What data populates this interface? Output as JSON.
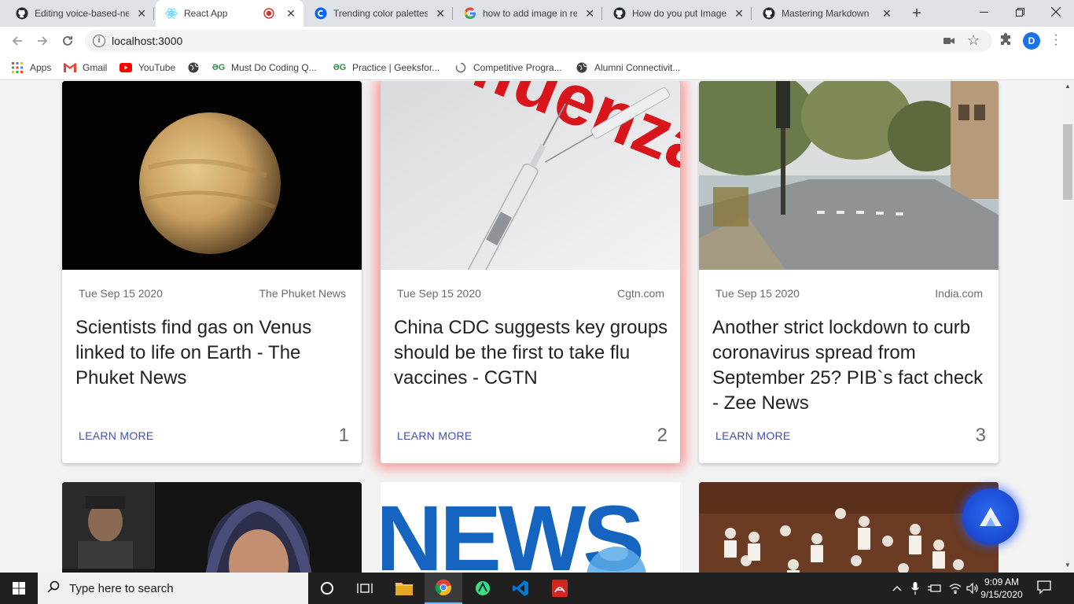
{
  "browser": {
    "tabs": [
      {
        "title": "Editing voice-based-ne",
        "icon": "github-icon",
        "active": false
      },
      {
        "title": "React App",
        "icon": "react-icon",
        "active": true
      },
      {
        "title": "Trending color palettes",
        "icon": "coolors-icon",
        "active": false
      },
      {
        "title": "how to add image in re",
        "icon": "google-icon",
        "active": false
      },
      {
        "title": "How do you put Image",
        "icon": "github-icon",
        "active": false
      },
      {
        "title": "Mastering Markdown",
        "icon": "github-icon",
        "active": false
      }
    ],
    "close_glyph": "✕",
    "new_tab_glyph": "+",
    "url": "localhost:3000",
    "profile_initial": "D"
  },
  "bookmarks": [
    {
      "label": "Apps",
      "icon": "apps-grid-icon"
    },
    {
      "label": "Gmail",
      "icon": "gmail-icon"
    },
    {
      "label": "YouTube",
      "icon": "youtube-icon"
    },
    {
      "label": "",
      "icon": "globe-icon"
    },
    {
      "label": "Must Do Coding Q...",
      "icon": "geeksforgeeks-icon"
    },
    {
      "label": "Practice | Geeksfor...",
      "icon": "geeksforgeeks-icon"
    },
    {
      "label": "Competitive Progra...",
      "icon": "loading-icon"
    },
    {
      "label": "Alumni Connectivit...",
      "icon": "globe-icon"
    }
  ],
  "cards": [
    {
      "date": "Tue Sep 15 2020",
      "source": "The Phuket News",
      "headline": "Scientists find gas on Venus linked to life on Earth - The Phuket News",
      "action": "LEARN MORE",
      "number": "1"
    },
    {
      "date": "Tue Sep 15 2020",
      "source": "Cgtn.com",
      "headline": "China CDC suggests key groups should be the first to take flu vaccines - CGTN",
      "action": "LEARN MORE",
      "number": "2",
      "image_text": "Influenza"
    },
    {
      "date": "Tue Sep 15 2020",
      "source": "India.com",
      "headline": "Another strict lockdown to curb coronavirus spread from September 25? PIB`s fact check - Zee News",
      "action": "LEARN MORE",
      "number": "3"
    }
  ],
  "next_row": {
    "news_image_text": "NEWS"
  },
  "colors": {
    "accent": "#3f51b5",
    "highlight_glow": "#ff4646",
    "fab": "#1e50d8"
  },
  "taskbar": {
    "search_placeholder": "Type here to search",
    "time": "9:09 AM",
    "date": "9/15/2020"
  }
}
